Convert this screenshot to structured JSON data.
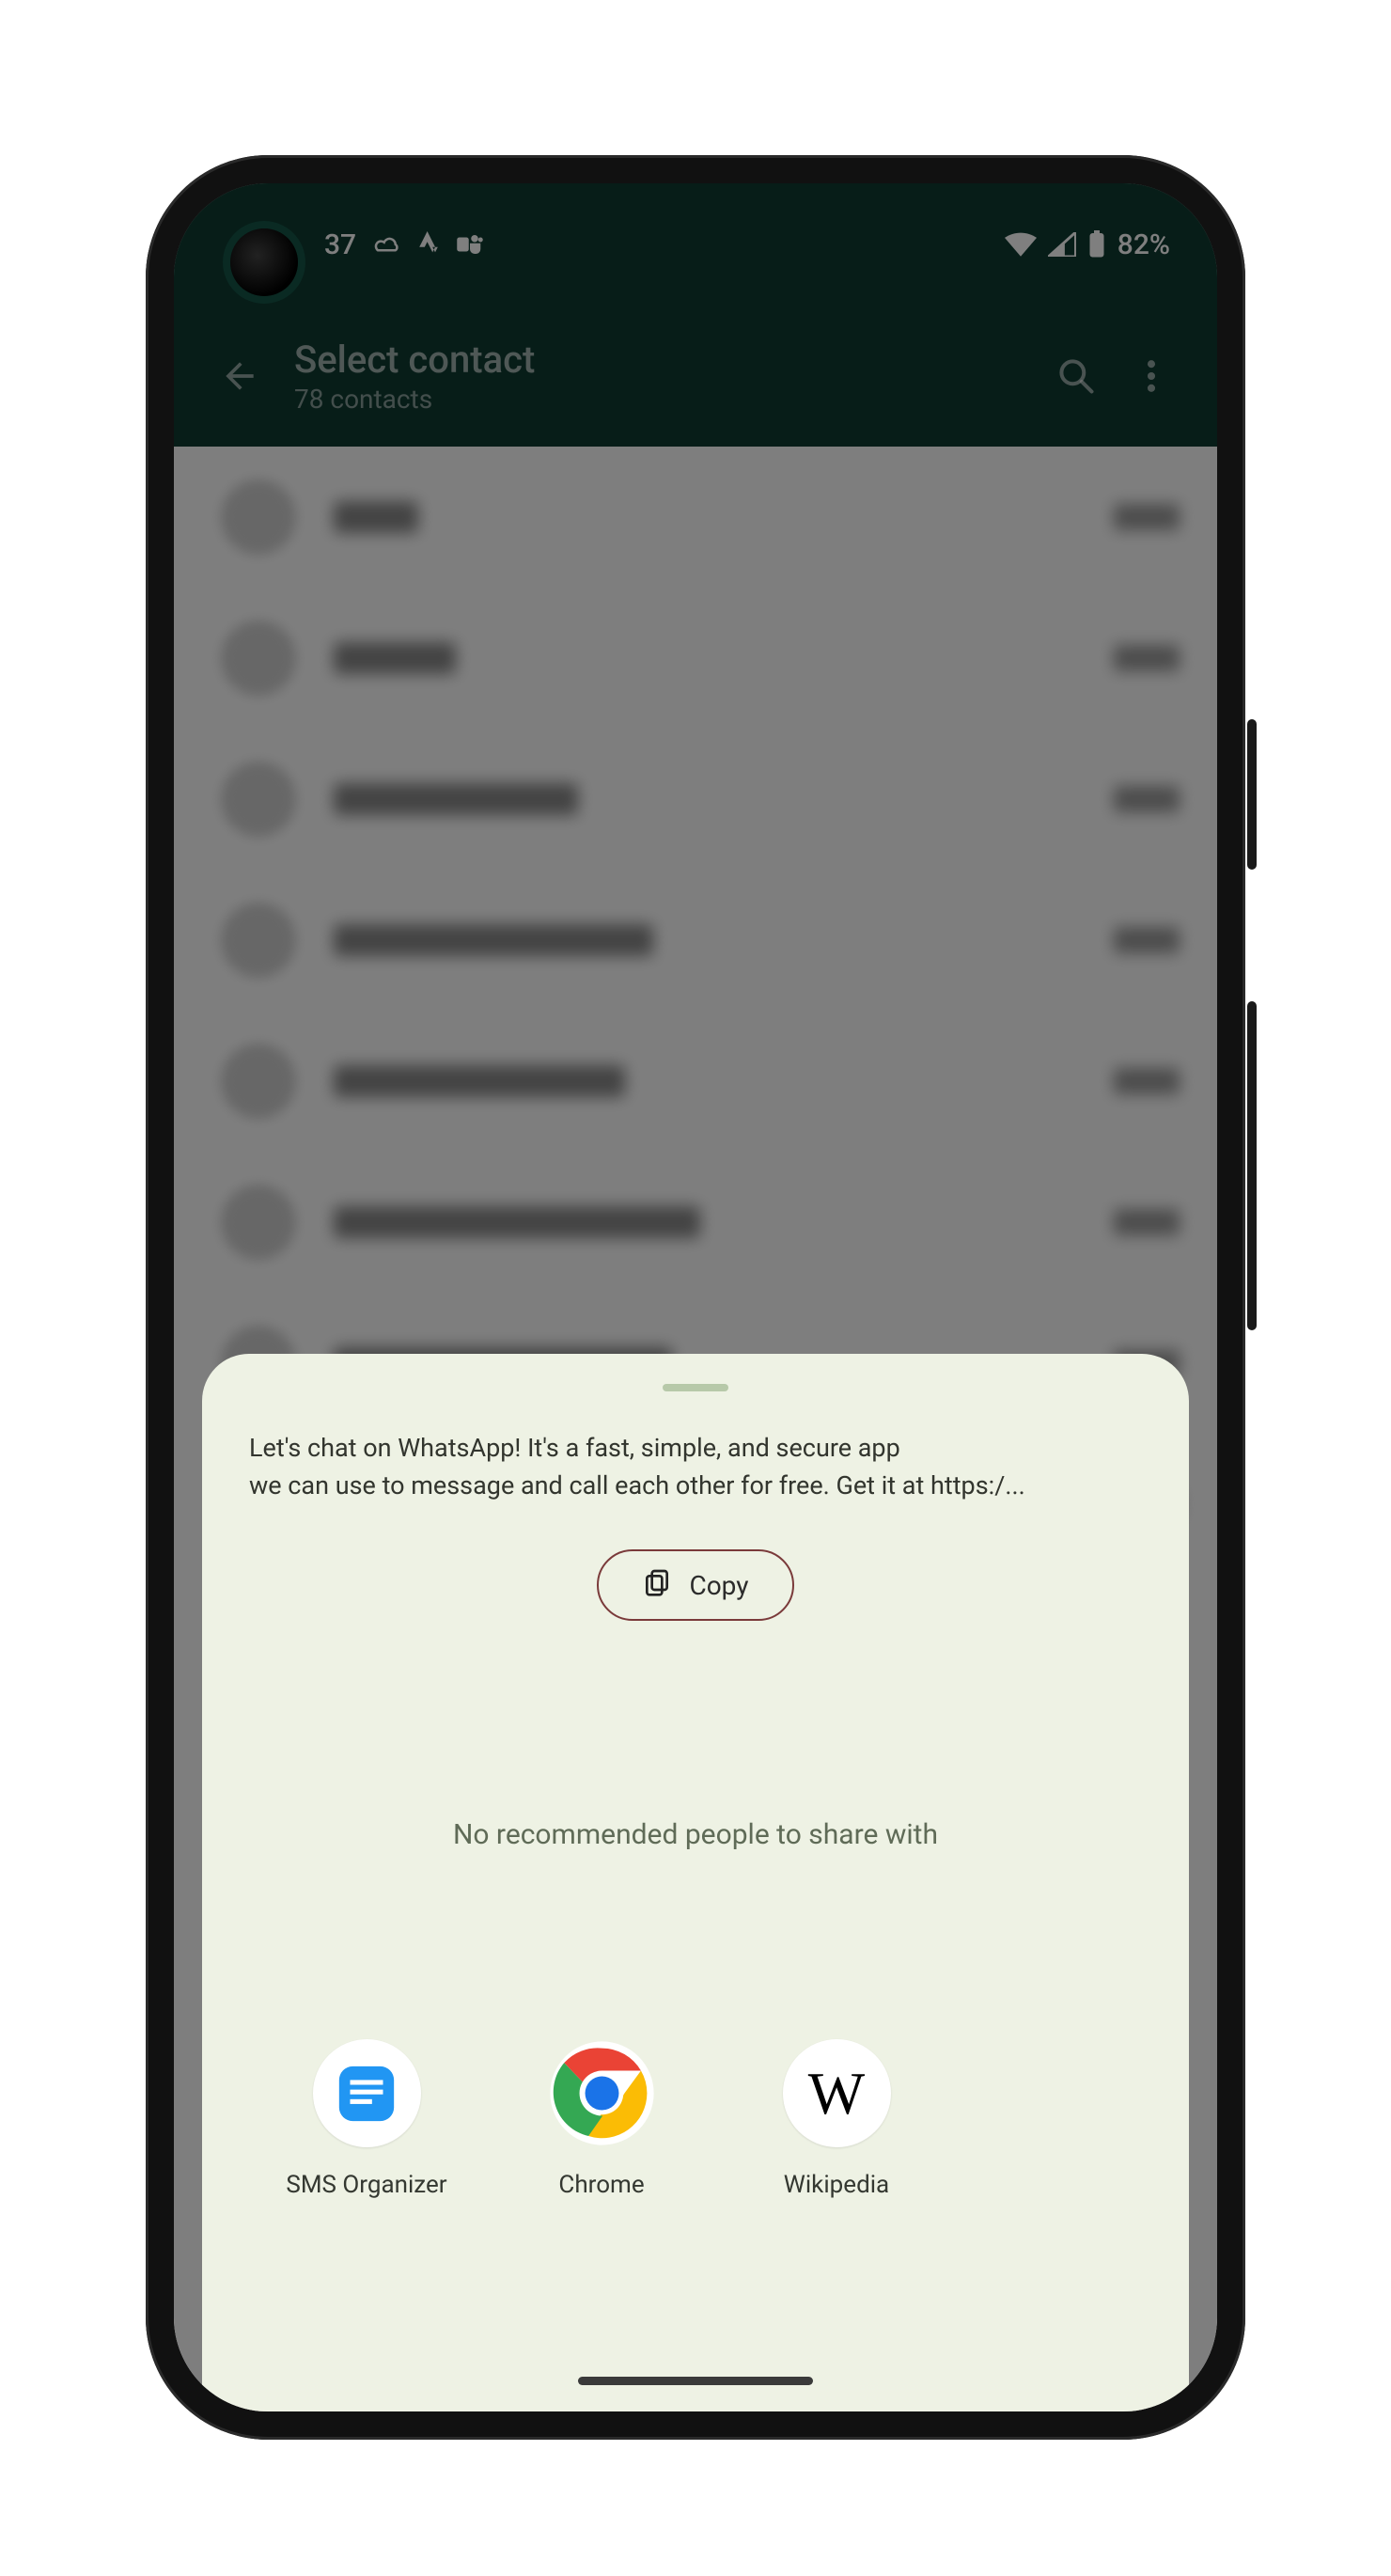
{
  "statusbar": {
    "time_fragment": "37",
    "battery_text": "82%",
    "left_icons": [
      "cloud-icon",
      "strava-icon",
      "teams-icon"
    ],
    "right_icons": [
      "wifi-icon",
      "signal-icon",
      "battery-icon"
    ]
  },
  "appbar": {
    "title": "Select contact",
    "subtitle": "78 contacts"
  },
  "contacts_blurred": [
    {
      "name_width": 90
    },
    {
      "name_width": 130
    },
    {
      "name_width": 260
    },
    {
      "name_width": 340
    },
    {
      "name_width": 310
    },
    {
      "name_width": 390
    },
    {
      "name_width": 360
    },
    {
      "name_width": 230
    }
  ],
  "share_sheet": {
    "preview_line1": "Let's chat on WhatsApp! It's a fast, simple, and secure app",
    "preview_line2": "we can use to message and call each other for free. Get it at https:/...",
    "copy_label": "Copy",
    "no_recommended": "No recommended people to share with",
    "apps": [
      {
        "id": "sms-organizer",
        "label": "SMS Organizer"
      },
      {
        "id": "chrome",
        "label": "Chrome"
      },
      {
        "id": "wikipedia",
        "label": "Wikipedia"
      }
    ]
  }
}
